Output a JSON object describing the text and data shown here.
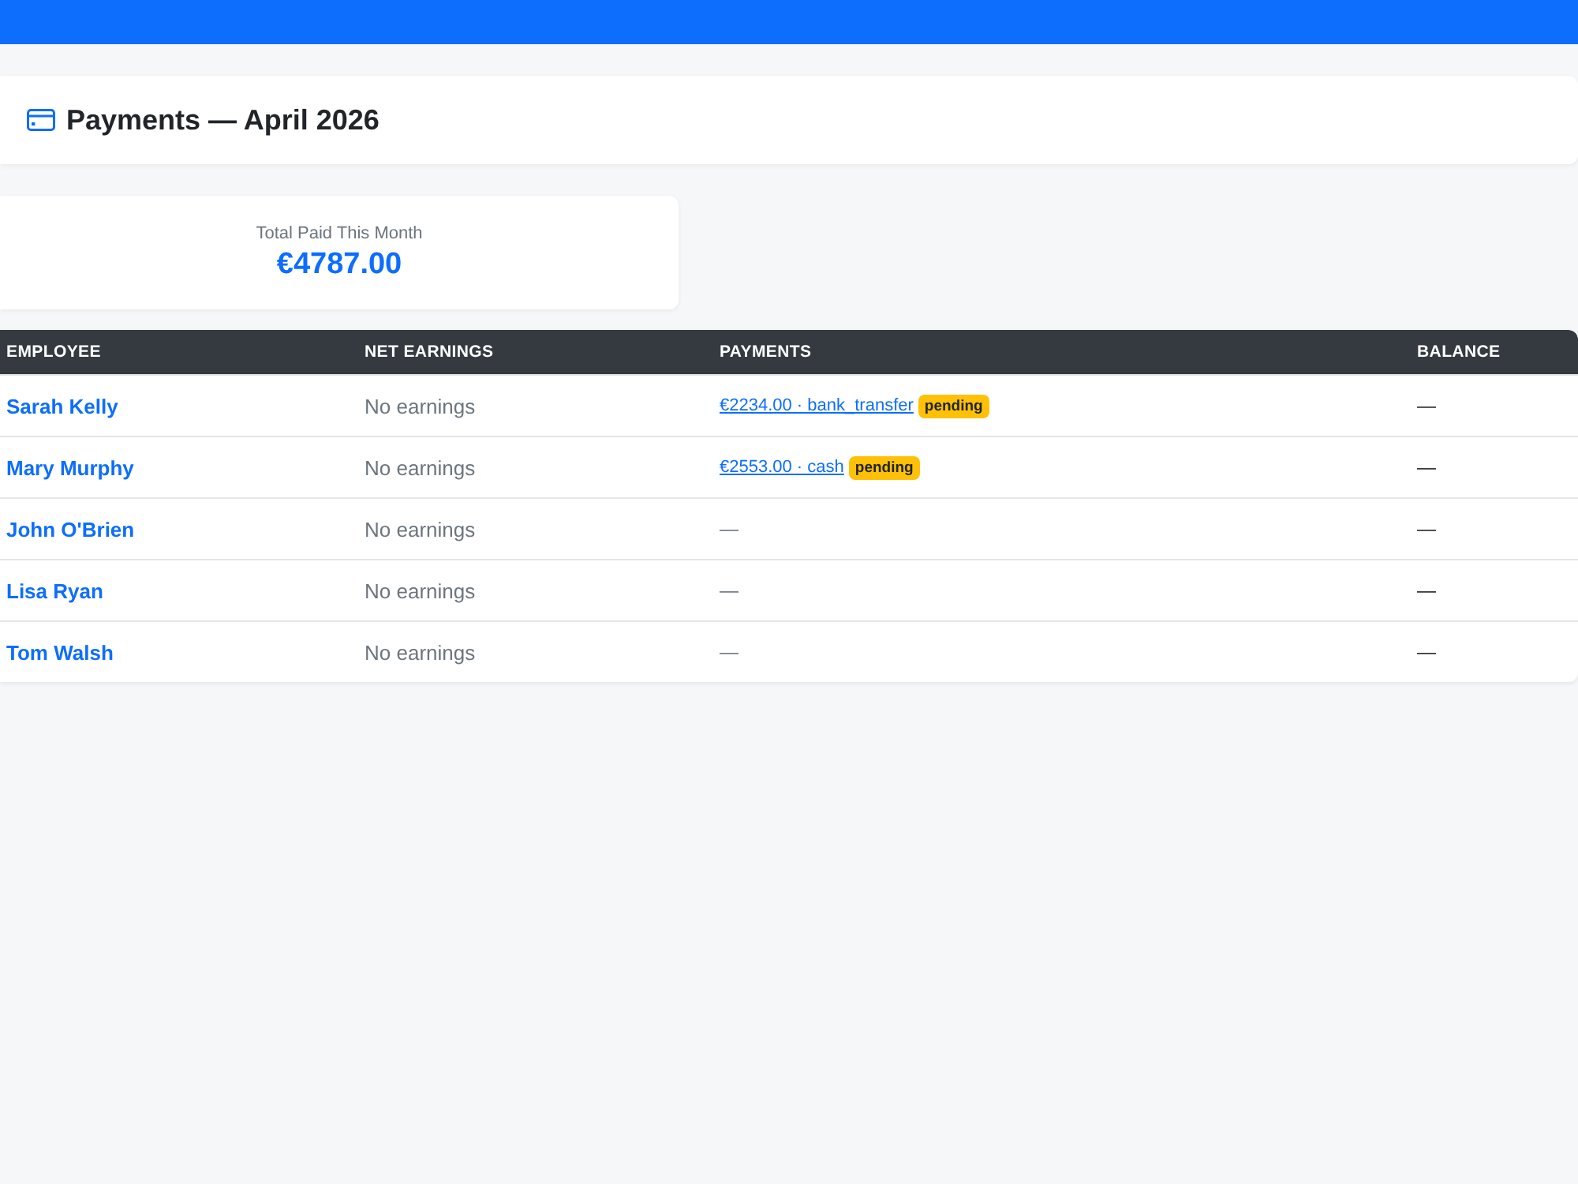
{
  "header": {
    "title": "Payments — April 2026"
  },
  "summary": {
    "label": "Total Paid This Month",
    "value": "€4787.00"
  },
  "table": {
    "columns": [
      "EMPLOYEE",
      "NET EARNINGS",
      "PAYMENTS",
      "BALANCE"
    ],
    "rows": [
      {
        "employee": "Sarah Kelly",
        "net_earnings": "No earnings",
        "payment": {
          "kind": "link",
          "text": "€2234.00 · bank_transfer",
          "badge": "pending"
        },
        "balance": "—"
      },
      {
        "employee": "Mary Murphy",
        "net_earnings": "No earnings",
        "payment": {
          "kind": "link",
          "text": "€2553.00 · cash",
          "badge": "pending"
        },
        "balance": "—"
      },
      {
        "employee": "John O'Brien",
        "net_earnings": "No earnings",
        "payment": {
          "kind": "empty",
          "text": "—"
        },
        "balance": "—"
      },
      {
        "employee": "Lisa Ryan",
        "net_earnings": "No earnings",
        "payment": {
          "kind": "empty",
          "text": "—"
        },
        "balance": "—"
      },
      {
        "employee": "Tom Walsh",
        "net_earnings": "No earnings",
        "payment": {
          "kind": "empty",
          "text": "—"
        },
        "balance": "—"
      }
    ]
  }
}
